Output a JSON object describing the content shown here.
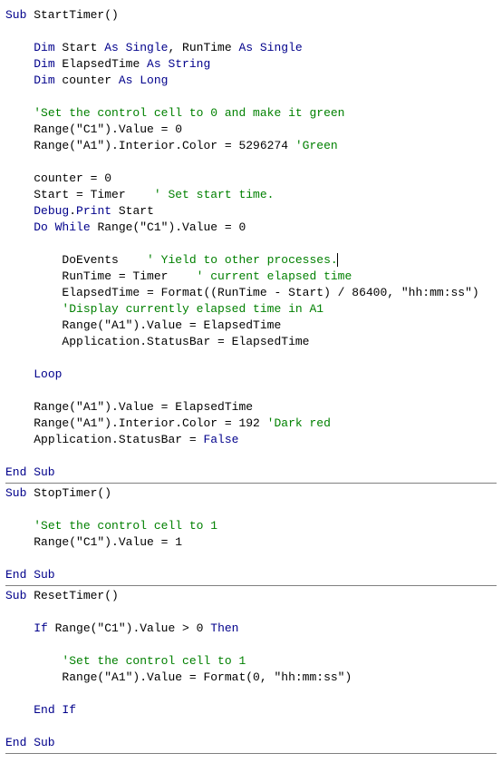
{
  "code": {
    "sub1": {
      "line1_kw1": "Sub",
      "line1_plain": " StartTimer()",
      "dim1_kw": "Dim",
      "dim1_mid": " Start ",
      "dim1_as": "As Single",
      "dim1_mid2": ", RunTime ",
      "dim1_as2": "As Single",
      "dim2_kw": "Dim",
      "dim2_mid": " ElapsedTime ",
      "dim2_as": "As String",
      "dim3_kw": "Dim",
      "dim3_mid": " counter ",
      "dim3_as": "As Long",
      "cm1": "'Set the control cell to 0 and make it green",
      "l_range1": "Range(\"C1\").Value = 0",
      "l_range2_a": "Range(\"A1\").Interior.Color = 5296274 ",
      "l_range2_cm": "'Green",
      "l_counter": "counter = 0",
      "l_start_a": "Start = Timer    ",
      "l_start_cm": "' Set start time.",
      "l_debug_kw": "Debug",
      "l_debug_mid": ".",
      "l_debug_kw2": "Print",
      "l_debug_tail": " Start",
      "l_dowh_kw": "Do While",
      "l_dowh_tail": " Range(\"C1\").Value = 0",
      "l_doev_a": "DoEvents    ",
      "l_doev_cm": "' Yield to other processes.",
      "l_runtime_a": "RunTime = Timer    ",
      "l_runtime_cm": "' current elapsed time",
      "l_elapsed": "ElapsedTime = Format((RunTime - Start) / 86400, \"hh:mm:ss\")",
      "l_cm2": "'Display currently elapsed time in A1",
      "l_rangeA1": "Range(\"A1\").Value = ElapsedTime",
      "l_status": "Application.StatusBar = ElapsedTime",
      "l_loop": "Loop",
      "l_rangeA1b": "Range(\"A1\").Value = ElapsedTime",
      "l_rangeA1c_a": "Range(\"A1\").Interior.Color = 192 ",
      "l_rangeA1c_cm": "'Dark red",
      "l_statusF": "Application.StatusBar = ",
      "l_statusF_kw": "False",
      "end": "End Sub"
    },
    "sub2": {
      "line1_kw": "Sub",
      "line1_plain": " StopTimer()",
      "cm": "'Set the control cell to 1",
      "l": "Range(\"C1\").Value = 1",
      "end": "End Sub"
    },
    "sub3": {
      "line1_kw": "Sub",
      "line1_plain": " ResetTimer()",
      "if_kw": "If",
      "if_mid": " Range(\"C1\").Value > 0 ",
      "if_then": "Then",
      "cm": "'Set the control cell to 1",
      "l": "Range(\"A1\").Value = Format(0, \"hh:mm:ss\")",
      "endif": "End If",
      "end": "End Sub"
    }
  }
}
